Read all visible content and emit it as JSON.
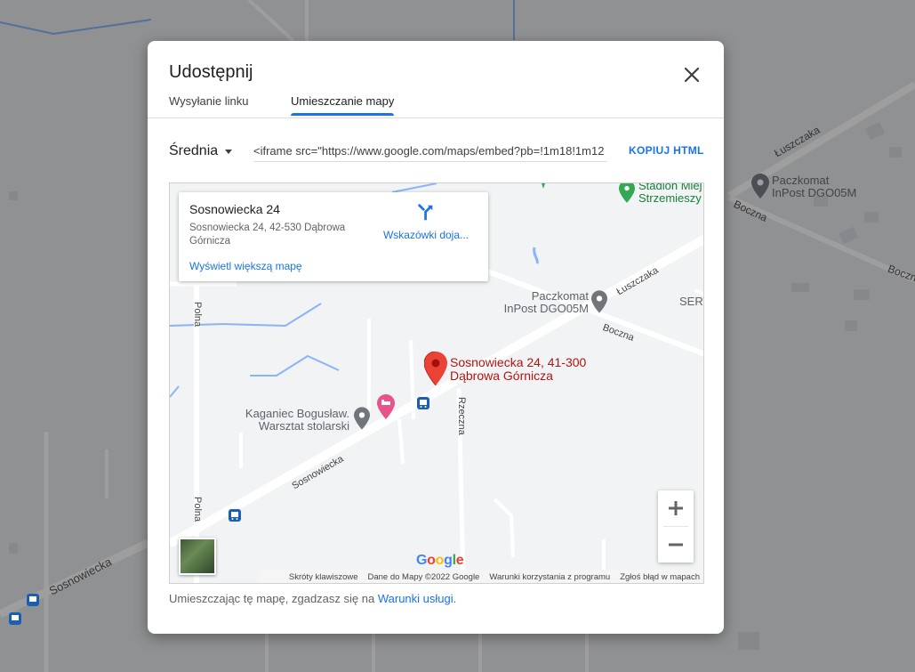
{
  "dialog": {
    "title": "Udostępnij",
    "tabs": [
      {
        "label": "Wysyłanie linku",
        "active": false
      },
      {
        "label": "Umieszczanie mapy",
        "active": true
      }
    ],
    "size_selected": "Średnia",
    "embed_code": "<iframe src=\"https://www.google.com/maps/embed?pb=!1m18!1m12",
    "copy_label": "KOPIUJ HTML",
    "footer_text": "Umieszczając tę mapę, zgadzasz się na",
    "footer_link": "Warunki usługi",
    "footer_end": "."
  },
  "preview": {
    "info_card": {
      "title": "Sosnowiecka 24",
      "address": "Sosnowiecka 24, 42-530 Dąbrowa Górnicza",
      "directions_label": "Wskazówki doja...",
      "larger_map_link": "Wyświetl większą mapę"
    },
    "pin_label_line1": "Sosnowiecka 24, 41-300",
    "pin_label_line2": "Dąbrowa Górnicza",
    "pois": {
      "paczkomat_line1": "Paczkomat",
      "paczkomat_line2": "InPost DGO05M",
      "kaganiec_line1": "Kaganiec Bogusław.",
      "kaganiec_line2": "Warsztat stolarski",
      "stadion_line1": "Stadion Miej",
      "stadion_line2": "Strzemieszy",
      "serv": "SERV"
    },
    "roads": {
      "sosnowiecka": "Sosnowiecka",
      "luszczaka": "Łuszczaka",
      "boczna": "Boczna",
      "polna_top": "Polna",
      "polna_bottom": "Polna",
      "rzeczna": "Rzeczna"
    },
    "google_logo": "Google",
    "attribution": {
      "shortcuts": "Skróty klawiszowe",
      "data": "Dane do Mapy ©2022 Google",
      "terms": "Warunki korzystania z programu",
      "report": "Zgłoś błąd w mapach"
    }
  },
  "background_map": {
    "luszczaka": "Łuszczaka",
    "boczna": "Boczna",
    "boczn": "Boczn",
    "paczkomat_line1": "Paczkomat",
    "paczkomat_line2": "InPost DGO05M",
    "sosnowiecka": "Sosnowiecka"
  },
  "colors": {
    "accent": "#1a73e8",
    "pin_red": "#ea4335",
    "pin_label": "#b31412",
    "poi_gray": "#70757a"
  }
}
